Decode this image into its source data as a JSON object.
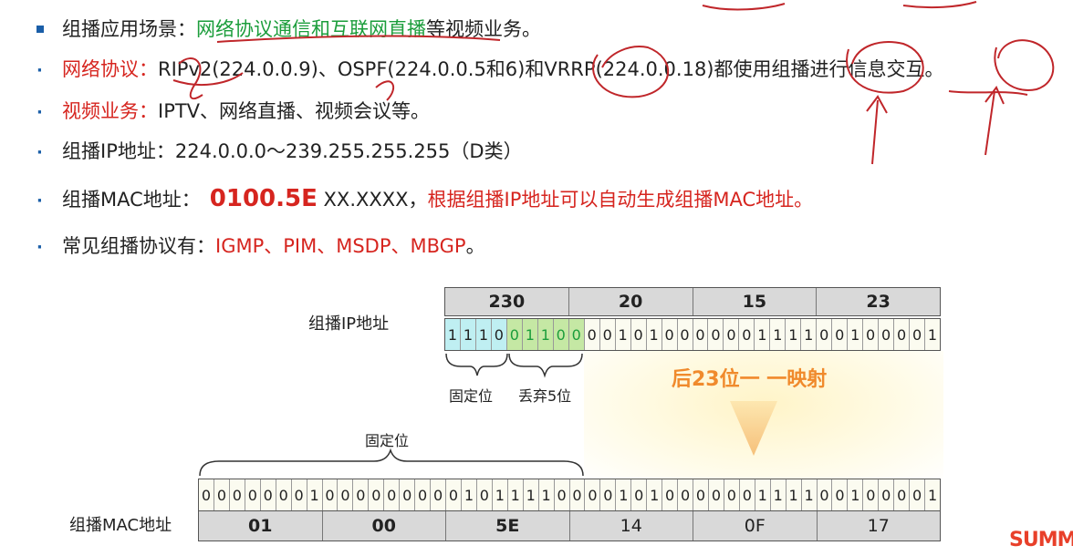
{
  "bullets": {
    "b1": {
      "prefix": "组播应用场景：",
      "highlight": "网络协议通信和互联网直播",
      "suffix": "等视频业务。"
    },
    "b2": {
      "label": "网络协议：",
      "text": "RIPv2(224.0.0.9)、OSPF(224.0.0.5和6)和VRRP(224.0.0.18)都使用组播进行信息交互。"
    },
    "b3": {
      "label": "视频业务：",
      "text": "IPTV、网络直播、视频会议等。"
    },
    "b4": {
      "text": "组播IP地址：224.0.0.0～239.255.255.255（D类）"
    },
    "b5": {
      "label": "组播MAC地址：",
      "big": "0100.5E",
      "mid": " XX.XXXX，",
      "tail": "根据组播IP地址可以自动生成组播MAC地址。"
    },
    "b6": {
      "label": "常见组播协议有：",
      "text": "IGMP、PIM、MSDP、MBGP",
      "end": "。"
    }
  },
  "diagram": {
    "ip_label": "组播IP地址",
    "mac_label": "组播MAC地址",
    "ip_bytes": [
      "230",
      "20",
      "15",
      "23"
    ],
    "ip_bits": [
      "1",
      "1",
      "1",
      "0",
      "0",
      "1",
      "1",
      "0",
      "0",
      "0",
      "0",
      "1",
      "0",
      "1",
      "0",
      "0",
      "0",
      "0",
      "0",
      "0",
      "1",
      "1",
      "1",
      "1",
      "0",
      "0",
      "1",
      "0",
      "0",
      "0",
      "0",
      "1"
    ],
    "fixed_label": "固定位",
    "discard_label": "丢弃5位",
    "mapping_label": "后23位一 一映射",
    "mac_fixed_label": "固定位",
    "mac_bits": [
      "0",
      "0",
      "0",
      "0",
      "0",
      "0",
      "0",
      "1",
      "0",
      "0",
      "0",
      "0",
      "0",
      "0",
      "0",
      "0",
      "0",
      "1",
      "0",
      "1",
      "1",
      "1",
      "1",
      "0",
      "0",
      "0",
      "0",
      "1",
      "0",
      "1",
      "0",
      "0",
      "0",
      "0",
      "0",
      "0",
      "1",
      "1",
      "1",
      "1",
      "0",
      "0",
      "1",
      "0",
      "0",
      "0",
      "0",
      "1"
    ],
    "mac_bytes": [
      "01",
      "00",
      "5E",
      "14",
      "0F",
      "17"
    ]
  },
  "colors": {
    "red": "#d6251f",
    "green": "#1b9d3b",
    "orange": "#f08a2c",
    "blue": "#1a5ea8"
  },
  "logo": "SUMM"
}
